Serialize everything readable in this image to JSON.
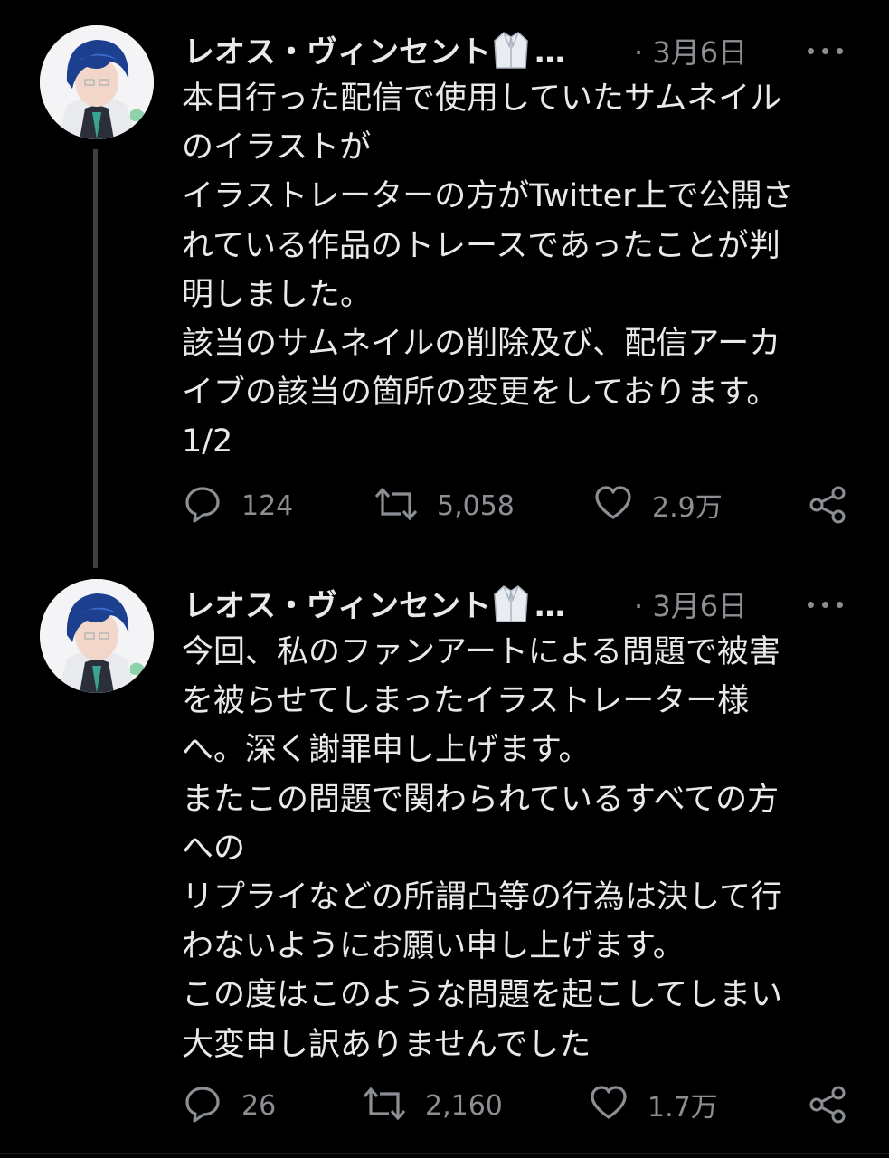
{
  "tweets": [
    {
      "author": "レオス・ヴィンセント",
      "ellipsis": "…",
      "date": "· 3月6日",
      "text": "本日行った配信で使用していたサムネイル\nのイラストが\nイラストレーターの方がTwitter上で公開さ\nれている作品のトレースであったことが判\n明しました。\n該当のサムネイルの削除及び、配信アーカ\nイブの該当の箇所の変更をしております。\n1/2",
      "replies": "124",
      "retweets": "5,058",
      "likes": "2.9万"
    },
    {
      "author": "レオス・ヴィンセント",
      "ellipsis": "…",
      "date": "· 3月6日",
      "text": "今回、私のファンアートによる問題で被害\nを被らせてしまったイラストレーター様\nへ。深く謝罪申し上げます。\nまたこの問題で関わられているすべての方\nへの\nリプライなどの所謂凸等の行為は決して行\nわないようにお願い申し上げます。\nこの度はこのような問題を起こしてしまい\n大変申し訳ありませんでした",
      "replies": "26",
      "retweets": "2,160",
      "likes": "1.7万"
    }
  ],
  "icons": [
    "lab-coat-icon",
    "reply-icon",
    "retweet-icon",
    "like-icon",
    "share-icon",
    "more-icon"
  ],
  "colors": {
    "background": "#000000",
    "text": "#e7e9ea",
    "secondary": "#8b8f94",
    "thread": "#3e4144"
  }
}
